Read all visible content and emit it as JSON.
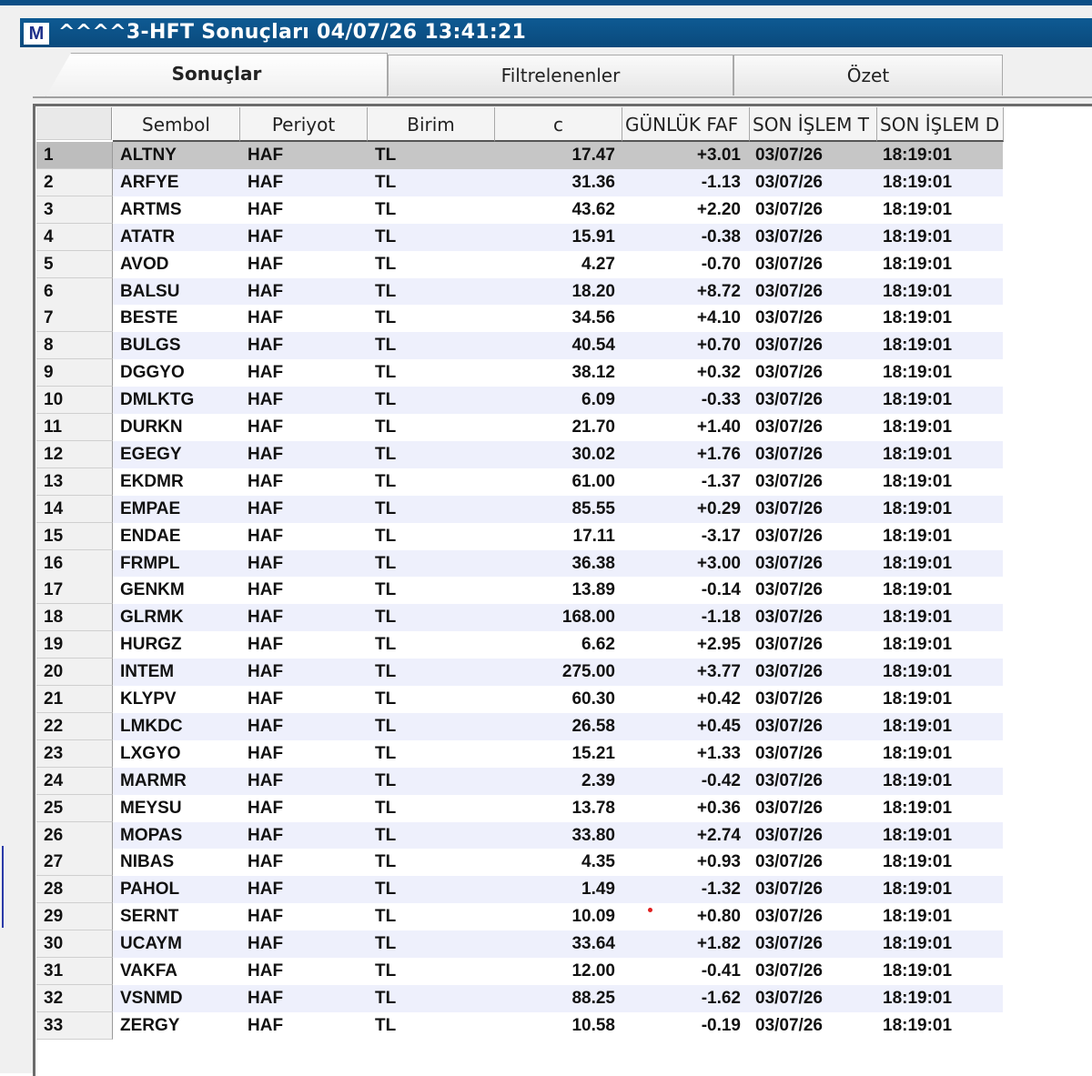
{
  "window": {
    "icon": "M",
    "title": "^^^^3-HFT Sonuçları  04/07/26 13:41:21"
  },
  "tabs": [
    {
      "label": "Sonuçlar",
      "active": true
    },
    {
      "label": "Filtrelenenler",
      "active": false
    },
    {
      "label": "Özet",
      "active": false
    }
  ],
  "columns": [
    "",
    "Sembol",
    "Periyot",
    "Birim",
    "c",
    "GÜNLÜK FAF",
    "SON İŞLEM T",
    "SON İŞLEM D"
  ],
  "selected_row": 1,
  "rows": [
    {
      "n": "1",
      "sym": "ALTNY",
      "per": "HAF",
      "bir": "TL",
      "c": "17.47",
      "g": "+3.01",
      "d": "03/07/26",
      "t": "18:19:01"
    },
    {
      "n": "2",
      "sym": "ARFYE",
      "per": "HAF",
      "bir": "TL",
      "c": "31.36",
      "g": "-1.13",
      "d": "03/07/26",
      "t": "18:19:01"
    },
    {
      "n": "3",
      "sym": "ARTMS",
      "per": "HAF",
      "bir": "TL",
      "c": "43.62",
      "g": "+2.20",
      "d": "03/07/26",
      "t": "18:19:01"
    },
    {
      "n": "4",
      "sym": "ATATR",
      "per": "HAF",
      "bir": "TL",
      "c": "15.91",
      "g": "-0.38",
      "d": "03/07/26",
      "t": "18:19:01"
    },
    {
      "n": "5",
      "sym": "AVOD",
      "per": "HAF",
      "bir": "TL",
      "c": "4.27",
      "g": "-0.70",
      "d": "03/07/26",
      "t": "18:19:01"
    },
    {
      "n": "6",
      "sym": "BALSU",
      "per": "HAF",
      "bir": "TL",
      "c": "18.20",
      "g": "+8.72",
      "d": "03/07/26",
      "t": "18:19:01"
    },
    {
      "n": "7",
      "sym": "BESTE",
      "per": "HAF",
      "bir": "TL",
      "c": "34.56",
      "g": "+4.10",
      "d": "03/07/26",
      "t": "18:19:01"
    },
    {
      "n": "8",
      "sym": "BULGS",
      "per": "HAF",
      "bir": "TL",
      "c": "40.54",
      "g": "+0.70",
      "d": "03/07/26",
      "t": "18:19:01"
    },
    {
      "n": "9",
      "sym": "DGGYO",
      "per": "HAF",
      "bir": "TL",
      "c": "38.12",
      "g": "+0.32",
      "d": "03/07/26",
      "t": "18:19:01"
    },
    {
      "n": "10",
      "sym": "DMLKTG",
      "per": "HAF",
      "bir": "TL",
      "c": "6.09",
      "g": "-0.33",
      "d": "03/07/26",
      "t": "18:19:01"
    },
    {
      "n": "11",
      "sym": "DURKN",
      "per": "HAF",
      "bir": "TL",
      "c": "21.70",
      "g": "+1.40",
      "d": "03/07/26",
      "t": "18:19:01"
    },
    {
      "n": "12",
      "sym": "EGEGY",
      "per": "HAF",
      "bir": "TL",
      "c": "30.02",
      "g": "+1.76",
      "d": "03/07/26",
      "t": "18:19:01"
    },
    {
      "n": "13",
      "sym": "EKDMR",
      "per": "HAF",
      "bir": "TL",
      "c": "61.00",
      "g": "-1.37",
      "d": "03/07/26",
      "t": "18:19:01"
    },
    {
      "n": "14",
      "sym": "EMPAE",
      "per": "HAF",
      "bir": "TL",
      "c": "85.55",
      "g": "+0.29",
      "d": "03/07/26",
      "t": "18:19:01"
    },
    {
      "n": "15",
      "sym": "ENDAE",
      "per": "HAF",
      "bir": "TL",
      "c": "17.11",
      "g": "-3.17",
      "d": "03/07/26",
      "t": "18:19:01"
    },
    {
      "n": "16",
      "sym": "FRMPL",
      "per": "HAF",
      "bir": "TL",
      "c": "36.38",
      "g": "+3.00",
      "d": "03/07/26",
      "t": "18:19:01"
    },
    {
      "n": "17",
      "sym": "GENKM",
      "per": "HAF",
      "bir": "TL",
      "c": "13.89",
      "g": "-0.14",
      "d": "03/07/26",
      "t": "18:19:01"
    },
    {
      "n": "18",
      "sym": "GLRMK",
      "per": "HAF",
      "bir": "TL",
      "c": "168.00",
      "g": "-1.18",
      "d": "03/07/26",
      "t": "18:19:01"
    },
    {
      "n": "19",
      "sym": "HURGZ",
      "per": "HAF",
      "bir": "TL",
      "c": "6.62",
      "g": "+2.95",
      "d": "03/07/26",
      "t": "18:19:01"
    },
    {
      "n": "20",
      "sym": "INTEM",
      "per": "HAF",
      "bir": "TL",
      "c": "275.00",
      "g": "+3.77",
      "d": "03/07/26",
      "t": "18:19:01"
    },
    {
      "n": "21",
      "sym": "KLYPV",
      "per": "HAF",
      "bir": "TL",
      "c": "60.30",
      "g": "+0.42",
      "d": "03/07/26",
      "t": "18:19:01"
    },
    {
      "n": "22",
      "sym": "LMKDC",
      "per": "HAF",
      "bir": "TL",
      "c": "26.58",
      "g": "+0.45",
      "d": "03/07/26",
      "t": "18:19:01"
    },
    {
      "n": "23",
      "sym": "LXGYO",
      "per": "HAF",
      "bir": "TL",
      "c": "15.21",
      "g": "+1.33",
      "d": "03/07/26",
      "t": "18:19:01"
    },
    {
      "n": "24",
      "sym": "MARMR",
      "per": "HAF",
      "bir": "TL",
      "c": "2.39",
      "g": "-0.42",
      "d": "03/07/26",
      "t": "18:19:01"
    },
    {
      "n": "25",
      "sym": "MEYSU",
      "per": "HAF",
      "bir": "TL",
      "c": "13.78",
      "g": "+0.36",
      "d": "03/07/26",
      "t": "18:19:01"
    },
    {
      "n": "26",
      "sym": "MOPAS",
      "per": "HAF",
      "bir": "TL",
      "c": "33.80",
      "g": "+2.74",
      "d": "03/07/26",
      "t": "18:19:01"
    },
    {
      "n": "27",
      "sym": "NIBAS",
      "per": "HAF",
      "bir": "TL",
      "c": "4.35",
      "g": "+0.93",
      "d": "03/07/26",
      "t": "18:19:01"
    },
    {
      "n": "28",
      "sym": "PAHOL",
      "per": "HAF",
      "bir": "TL",
      "c": "1.49",
      "g": "-1.32",
      "d": "03/07/26",
      "t": "18:19:01"
    },
    {
      "n": "29",
      "sym": "SERNT",
      "per": "HAF",
      "bir": "TL",
      "c": "10.09",
      "g": "+0.80",
      "d": "03/07/26",
      "t": "18:19:01"
    },
    {
      "n": "30",
      "sym": "UCAYM",
      "per": "HAF",
      "bir": "TL",
      "c": "33.64",
      "g": "+1.82",
      "d": "03/07/26",
      "t": "18:19:01"
    },
    {
      "n": "31",
      "sym": "VAKFA",
      "per": "HAF",
      "bir": "TL",
      "c": "12.00",
      "g": "-0.41",
      "d": "03/07/26",
      "t": "18:19:01"
    },
    {
      "n": "32",
      "sym": "VSNMD",
      "per": "HAF",
      "bir": "TL",
      "c": "88.25",
      "g": "-1.62",
      "d": "03/07/26",
      "t": "18:19:01"
    },
    {
      "n": "33",
      "sym": "ZERGY",
      "per": "HAF",
      "bir": "TL",
      "c": "10.58",
      "g": "-0.19",
      "d": "03/07/26",
      "t": "18:19:01"
    }
  ]
}
